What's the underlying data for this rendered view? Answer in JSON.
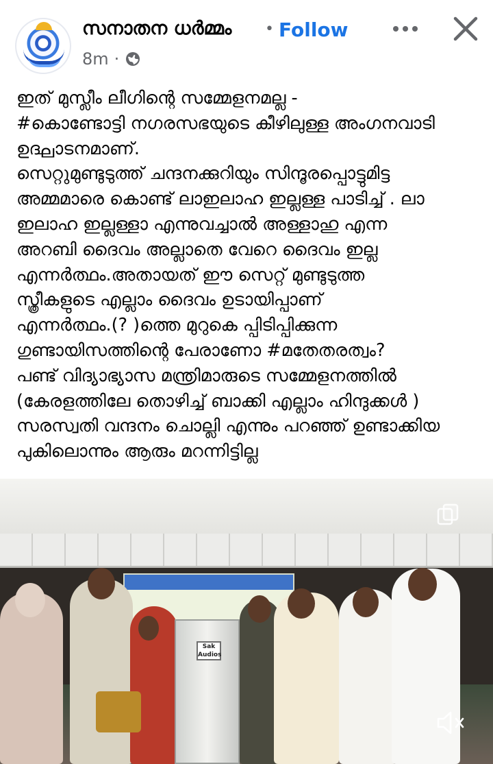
{
  "post": {
    "page_name": "സനാതന ധർമ്മം",
    "separator": "•",
    "follow_label": "Follow",
    "time": "8m",
    "time_dot": "·",
    "lines": [
      "ഇത് മുസ്ലീം ലീഗിന്റെ സമ്മേളനമല്ല -",
      "#കൊണ്ടോട്ടി നഗരസഭയുടെ കീഴിലുള്ള അംഗനവാടി",
      "ഉദ്ഘാടനമാണ്.",
      "സെറ്റുമുണ്ടുടുത്ത് ചന്ദനക്കുറിയും സിന്ദൂരപ്പൊട്ടുമിട്ട",
      "അമ്മമാരെ കൊണ്ട് ലാഇലാഹ ഇല്ലള്ള പാടിച്ച് . ലാ",
      "ഇലാഹ ഇല്ലള്ളാ എന്നുവച്ചാൽ അള്ളാഹു എന്ന",
      "അറബി ദൈവം അല്ലാതെ വേറെ ദൈവം ഇല്ല",
      "എന്നർത്ഥം.അതായത് ഈ സെറ്റ് മുണ്ടുടുത്ത",
      "സ്ത്രീകളുടെ എല്ലാം ദൈവം ഉടായിപ്പാണ്",
      "എന്നർത്ഥം.(? )ത്തെ മുറുകെ പ്പിടിപ്പിക്കുന്ന",
      "ഗുണ്ടായിസത്തിന്റെ പേരാണോ #മതേതരത്വം?",
      "പണ്ട് വിദ്യാഭ്യാസ മന്ത്രിമാരുടെ സമ്മേളനത്തിൽ",
      "(കേരളത്തിലേ തൊഴിച്ച് ബാക്കി എല്ലാം  ഹിന്ദുക്കൾ )",
      "സരസ്വതി വന്ദനം ചൊല്ലി എന്നും പറഞ്ഞ് ഉണ്ടാക്കിയ",
      "പുകിലൊന്നും ആരും മറന്നിട്ടില്ല"
    ]
  },
  "media": {
    "podium_label_1": "Sak",
    "podium_label_2": "Audios"
  },
  "icons": {
    "more": "more-horizontal-icon",
    "close": "close-icon",
    "globe": "globe-icon",
    "copy": "copy-icon",
    "mute": "mute-icon"
  },
  "colors": {
    "follow": "#1b74e4",
    "secondary_text": "#65676b",
    "text": "#050505"
  }
}
